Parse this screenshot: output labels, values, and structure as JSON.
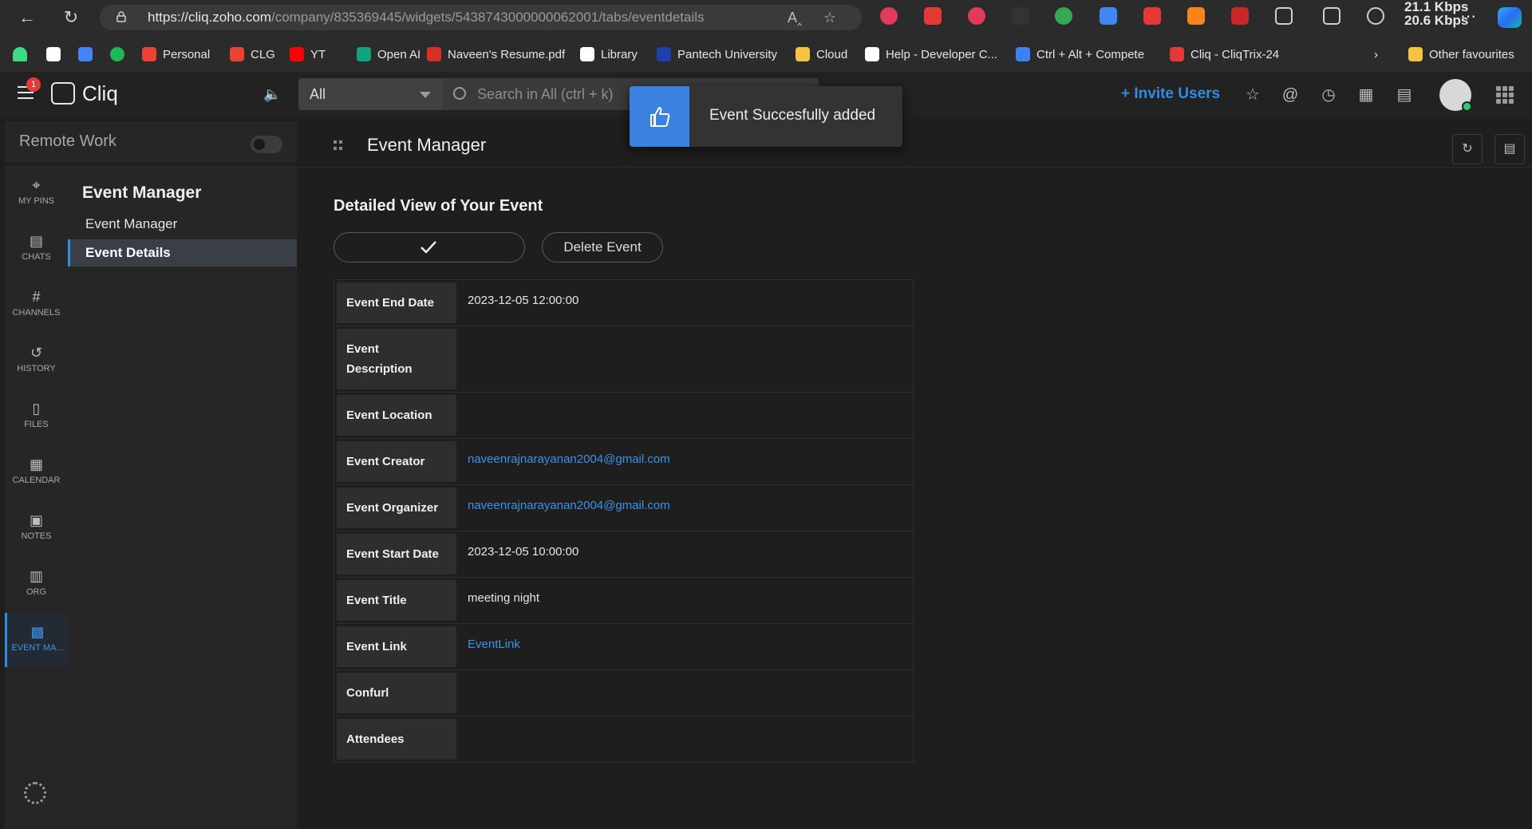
{
  "browser": {
    "url_host": "https://cliq.zoho.com",
    "url_path": "/company/835369445/widgets/5438743000000062001/tabs/eventdetails",
    "network_speed_1": "21.1 Kbps",
    "network_speed_2": "20.6 Kbps",
    "bookmarks": [
      {
        "label": "Personal",
        "color": "#ea4335"
      },
      {
        "label": "CLG",
        "color": "#ea4335"
      },
      {
        "label": "YT",
        "color": "#ff0000"
      },
      {
        "label": "Open AI",
        "color": "#10a37f"
      },
      {
        "label": "Naveen's Resume.pdf",
        "color": "#d93025"
      },
      {
        "label": "Library",
        "color": "#ffffff"
      },
      {
        "label": "Pantech University",
        "color": "#1e40af"
      },
      {
        "label": "Cloud",
        "color": "#f5c542"
      },
      {
        "label": "Help - Developer C...",
        "color": "#ffffff"
      },
      {
        "label": "Ctrl + Alt + Compete",
        "color": "#3b82f6"
      },
      {
        "label": "Cliq - CliqTrix-24",
        "color": "#e53935"
      }
    ],
    "other_favourites": "Other favourites"
  },
  "header": {
    "notification_count": "1",
    "app_name": "Cliq",
    "search_scope": "All",
    "search_placeholder": "Search in All (ctrl + k)",
    "invite_label": "+ Invite Users"
  },
  "toast": {
    "message": "Event Succesfully added"
  },
  "remote_work": {
    "label": "Remote Work"
  },
  "rail": [
    {
      "label": "MY PINS",
      "icon": "pin-icon"
    },
    {
      "label": "CHATS",
      "icon": "chat-icon"
    },
    {
      "label": "CHANNELS",
      "icon": "hash-icon"
    },
    {
      "label": "HISTORY",
      "icon": "history-icon"
    },
    {
      "label": "FILES",
      "icon": "file-icon"
    },
    {
      "label": "CALENDAR",
      "icon": "calendar-icon"
    },
    {
      "label": "NOTES",
      "icon": "notes-icon"
    },
    {
      "label": "ORG",
      "icon": "org-icon"
    },
    {
      "label": "EVENT MA...",
      "icon": "grid-icon",
      "active": true
    }
  ],
  "subnav": {
    "title": "Event Manager",
    "items": [
      {
        "label": "Event Manager"
      },
      {
        "label": "Event Details",
        "selected": true
      }
    ]
  },
  "main": {
    "page_title": "Event Manager",
    "section_title": "Detailed View of Your Event",
    "delete_label": "Delete Event",
    "details": [
      {
        "key": "Event End Date",
        "value": "2023-12-05 12:00:00"
      },
      {
        "key": "Event Description",
        "value": ""
      },
      {
        "key": "Event Location",
        "value": ""
      },
      {
        "key": "Event Creator",
        "value": "naveenrajnarayanan2004@gmail.com",
        "link": true
      },
      {
        "key": "Event Organizer",
        "value": "naveenrajnarayanan2004@gmail.com",
        "link": true
      },
      {
        "key": "Event Start Date",
        "value": "2023-12-05 10:00:00"
      },
      {
        "key": "Event Title",
        "value": "meeting night"
      },
      {
        "key": "Event Link",
        "value": "EventLink",
        "link": true
      },
      {
        "key": "Confurl",
        "value": ""
      },
      {
        "key": "Attendees",
        "value": ""
      }
    ]
  }
}
